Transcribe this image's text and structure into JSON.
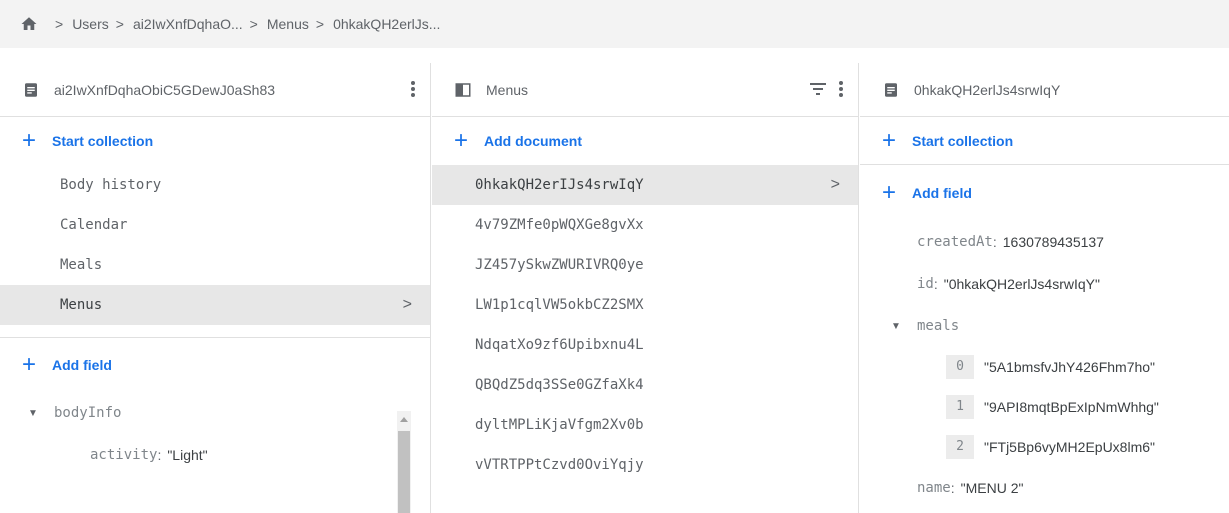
{
  "breadcrumb": {
    "items": [
      "Users",
      "ai2IwXnfDqhaO...",
      "Menus",
      "0hkakQH2erlJs..."
    ]
  },
  "panel_user": {
    "title": "ai2IwXnfDqhaObiC5GDewJ0aSh83",
    "start_collection": "Start collection",
    "collections": [
      "Body history",
      "Calendar",
      "Meals",
      "Menus"
    ],
    "selected_index": 3,
    "add_field": "Add field",
    "fields": {
      "bodyInfo_key": "bodyInfo",
      "activity_key": "activity",
      "activity_value": "\"Light\""
    }
  },
  "panel_menus": {
    "title": "Menus",
    "add_document": "Add document",
    "documents": [
      "0hkakQH2erIJs4srwIqY",
      "4v79ZMfe0pWQXGe8gvXx",
      "JZ457ySkwZWURIVRQ0ye",
      "LW1p1cqlVW5okbCZ2SMX",
      "NdqatXo9zf6Upibxnu4L",
      "QBQdZ5dq3SSe0GZfaXk4",
      "dyltMPLiKjaVfgm2Xv0b",
      "vVTRTPPtCzvd0OviYqjy"
    ],
    "selected_index": 0
  },
  "panel_doc": {
    "title": "0hkakQH2erlJs4srwIqY",
    "start_collection": "Start collection",
    "add_field": "Add field",
    "createdAt_key": "createdAt",
    "createdAt_value": "1630789435137",
    "id_key": "id",
    "id_value": "\"0hkakQH2erlJs4srwIqY\"",
    "meals_key": "meals",
    "meals": [
      {
        "index": "0",
        "value": "\"5A1bmsfvJhY426Fhm7ho\""
      },
      {
        "index": "1",
        "value": "\"9API8mqtBpExIpNmWhhg\""
      },
      {
        "index": "2",
        "value": "\"FTj5Bp6vyMH2EpUx8lm6\""
      }
    ],
    "name_key": "name",
    "name_value": "\"MENU 2\""
  },
  "colors": {
    "accent": "#1a73e8",
    "selected_bg": "#e7e7e7",
    "breadcrumb_bg": "#f3f3f3"
  }
}
